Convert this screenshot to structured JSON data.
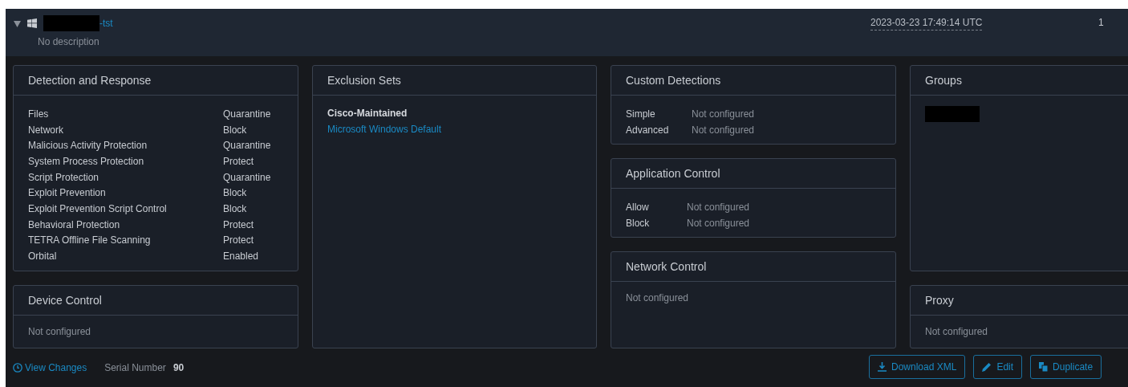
{
  "policy": {
    "expanded": true,
    "name_suffix": "-tst",
    "description": "No description",
    "timestamp": "2023-03-23 17:49:14 UTC",
    "count": "1"
  },
  "detection_and_response": {
    "title": "Detection and Response",
    "rows": [
      {
        "label": "Files",
        "value": "Quarantine"
      },
      {
        "label": "Network",
        "value": "Block"
      },
      {
        "label": "Malicious Activity Protection",
        "value": "Quarantine"
      },
      {
        "label": "System Process Protection",
        "value": "Protect"
      },
      {
        "label": "Script Protection",
        "value": "Quarantine"
      },
      {
        "label": "Exploit Prevention",
        "value": "Block"
      },
      {
        "label": "Exploit Prevention Script Control",
        "value": "Block"
      },
      {
        "label": "Behavioral Protection",
        "value": "Protect"
      },
      {
        "label": "TETRA Offline File Scanning",
        "value": "Protect"
      },
      {
        "label": "Orbital",
        "value": "Enabled"
      }
    ]
  },
  "device_control": {
    "title": "Device Control",
    "text": "Not configured"
  },
  "exclusion_sets": {
    "title": "Exclusion Sets",
    "items": [
      {
        "kind": "heading",
        "text": "Cisco-Maintained"
      },
      {
        "kind": "link",
        "text": "Microsoft Windows Default"
      }
    ]
  },
  "custom_detections": {
    "title": "Custom Detections",
    "rows": [
      {
        "label": "Simple",
        "value": "Not configured"
      },
      {
        "label": "Advanced",
        "value": "Not configured"
      }
    ]
  },
  "application_control": {
    "title": "Application Control",
    "rows": [
      {
        "label": "Allow",
        "value": "Not configured"
      },
      {
        "label": "Block",
        "value": "Not configured"
      }
    ]
  },
  "network_control": {
    "title": "Network Control",
    "text": "Not configured"
  },
  "groups": {
    "title": "Groups"
  },
  "proxy": {
    "title": "Proxy",
    "text": "Not configured"
  },
  "footer": {
    "view_changes": "View Changes",
    "serial_label": "Serial Number",
    "serial_value": "90",
    "buttons": [
      {
        "kind": "download",
        "label": "Download XML"
      },
      {
        "kind": "edit",
        "label": "Edit"
      },
      {
        "kind": "duplicate",
        "label": "Duplicate"
      }
    ]
  }
}
